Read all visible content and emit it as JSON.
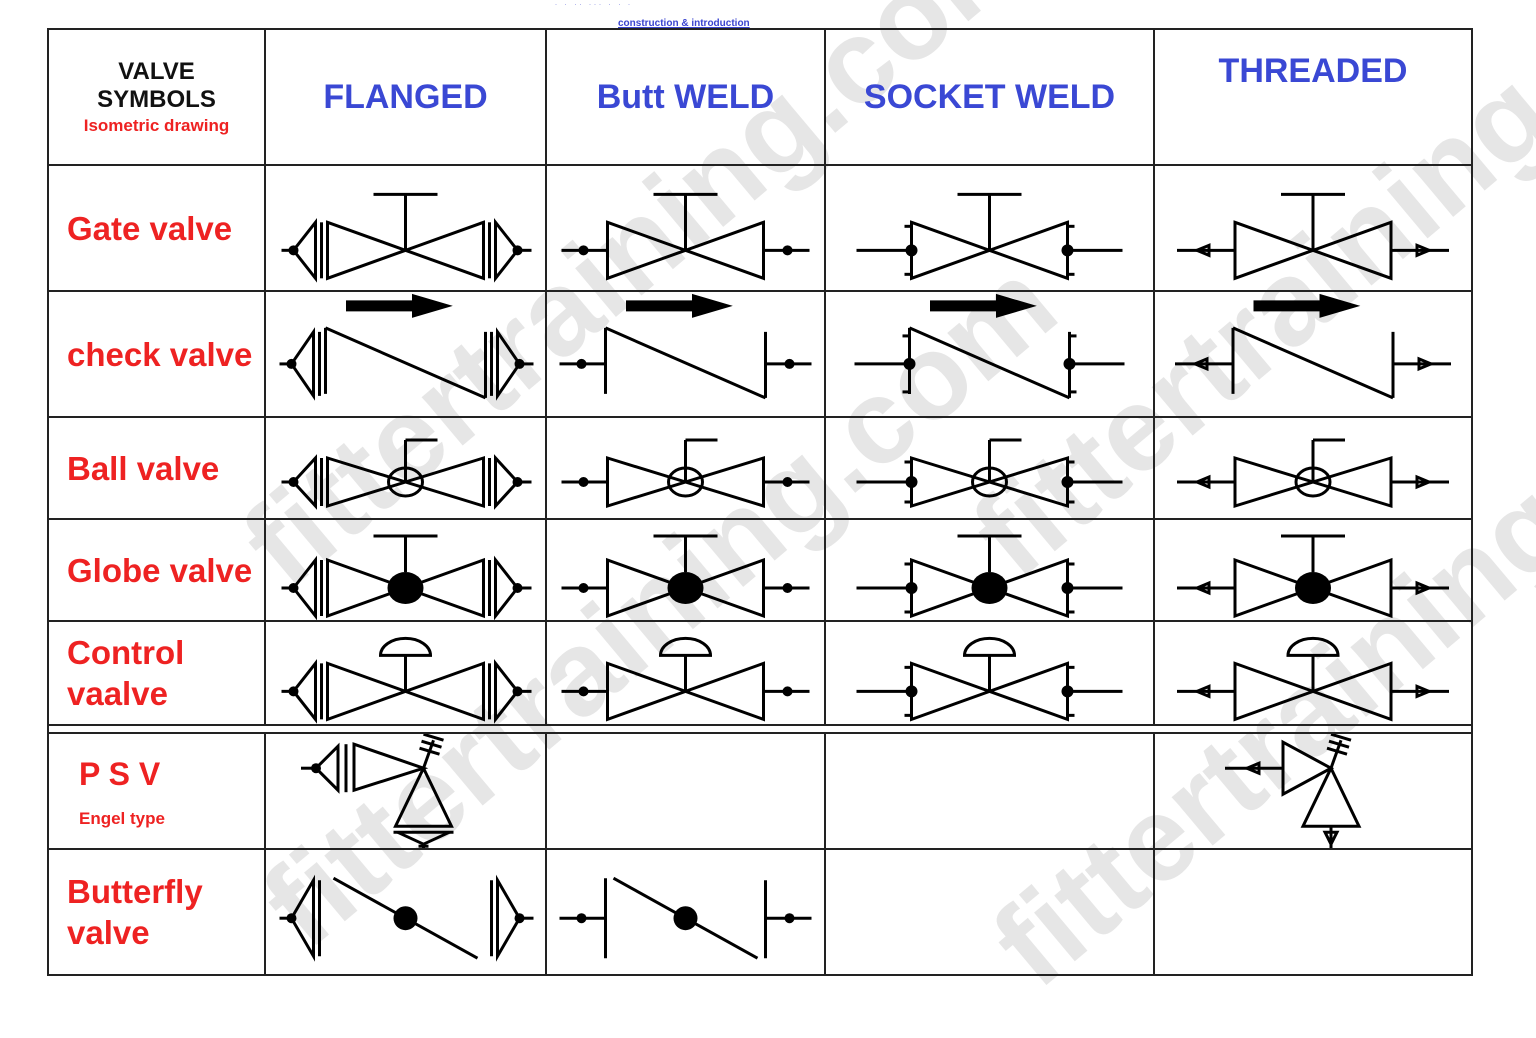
{
  "page": {
    "top_caption": "construction & introduction",
    "watermark_text": "fittertraining.com"
  },
  "header": {
    "title_line1": "VALVE",
    "title_line2": "SYMBOLS",
    "subtitle": "Isometric drawing",
    "columns": [
      "FLANGED",
      "Butt WELD",
      "SOCKET WELD",
      "THREADED"
    ]
  },
  "colors": {
    "label_red": "#ee2222",
    "header_blue": "#3a48d4",
    "line": "#000000",
    "watermark": "#e6e6e6"
  },
  "rows": [
    {
      "label": "Gate valve",
      "sub": "",
      "type": "gate",
      "cells": [
        {
          "end": "flanged"
        },
        {
          "end": "butt"
        },
        {
          "end": "socket"
        },
        {
          "end": "threaded"
        }
      ]
    },
    {
      "label": "check valve",
      "sub": "",
      "type": "check",
      "cells": [
        {
          "end": "flanged"
        },
        {
          "end": "butt"
        },
        {
          "end": "socket"
        },
        {
          "end": "threaded"
        }
      ]
    },
    {
      "label": "Ball valve",
      "sub": "",
      "type": "ball",
      "cells": [
        {
          "end": "flanged"
        },
        {
          "end": "butt"
        },
        {
          "end": "socket"
        },
        {
          "end": "threaded"
        }
      ]
    },
    {
      "label": "Globe valve",
      "sub": "",
      "type": "globe",
      "cells": [
        {
          "end": "flanged"
        },
        {
          "end": "butt"
        },
        {
          "end": "socket"
        },
        {
          "end": "threaded"
        }
      ]
    },
    {
      "label": "Control vaalve",
      "sub": "",
      "type": "control",
      "cells": [
        {
          "end": "flanged"
        },
        {
          "end": "butt"
        },
        {
          "end": "socket"
        },
        {
          "end": "threaded"
        }
      ]
    },
    {
      "label": "P S V",
      "sub": "Engel type",
      "type": "psv",
      "cells": [
        {
          "end": "flanged"
        },
        {
          "end": "none"
        },
        {
          "end": "none"
        },
        {
          "end": "threaded"
        }
      ]
    },
    {
      "label": "Butterfly valve",
      "sub": "",
      "type": "butterfly",
      "cells": [
        {
          "end": "flanged"
        },
        {
          "end": "butt"
        },
        {
          "end": "none"
        },
        {
          "end": "none"
        }
      ]
    }
  ]
}
